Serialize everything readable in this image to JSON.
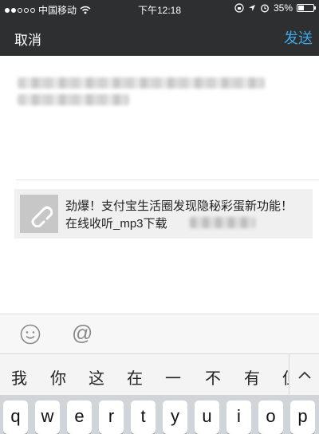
{
  "status_bar": {
    "carrier": "中国移动",
    "time": "下午12:18",
    "battery": "35%",
    "battery_level": 0.35,
    "icons": [
      "signal-dots",
      "wifi-icon",
      "rotation-lock-icon",
      "location-arrow-icon",
      "alarm-icon",
      "battery-icon"
    ]
  },
  "nav": {
    "cancel": "取消",
    "send": "发送",
    "send_color": "#3fa6e8",
    "bar_color": "#2e2f31"
  },
  "share_card": {
    "icon": "link-icon",
    "title": "劲爆！支付宝生活圈发现隐秘彩蛋新功能！",
    "subtitle": "在线收听_mp3下载"
  },
  "input_bar": {
    "emoji_icon": "smile-icon",
    "at_symbol": "@"
  },
  "candidates": {
    "items": [
      "我",
      "你",
      "这",
      "在",
      "一",
      "不",
      "有",
      "但"
    ],
    "expand_icon": "chevron-up-icon"
  },
  "keyboard": {
    "row1": [
      "q",
      "w",
      "e",
      "r",
      "t",
      "y",
      "u",
      "i",
      "o",
      "p"
    ]
  }
}
